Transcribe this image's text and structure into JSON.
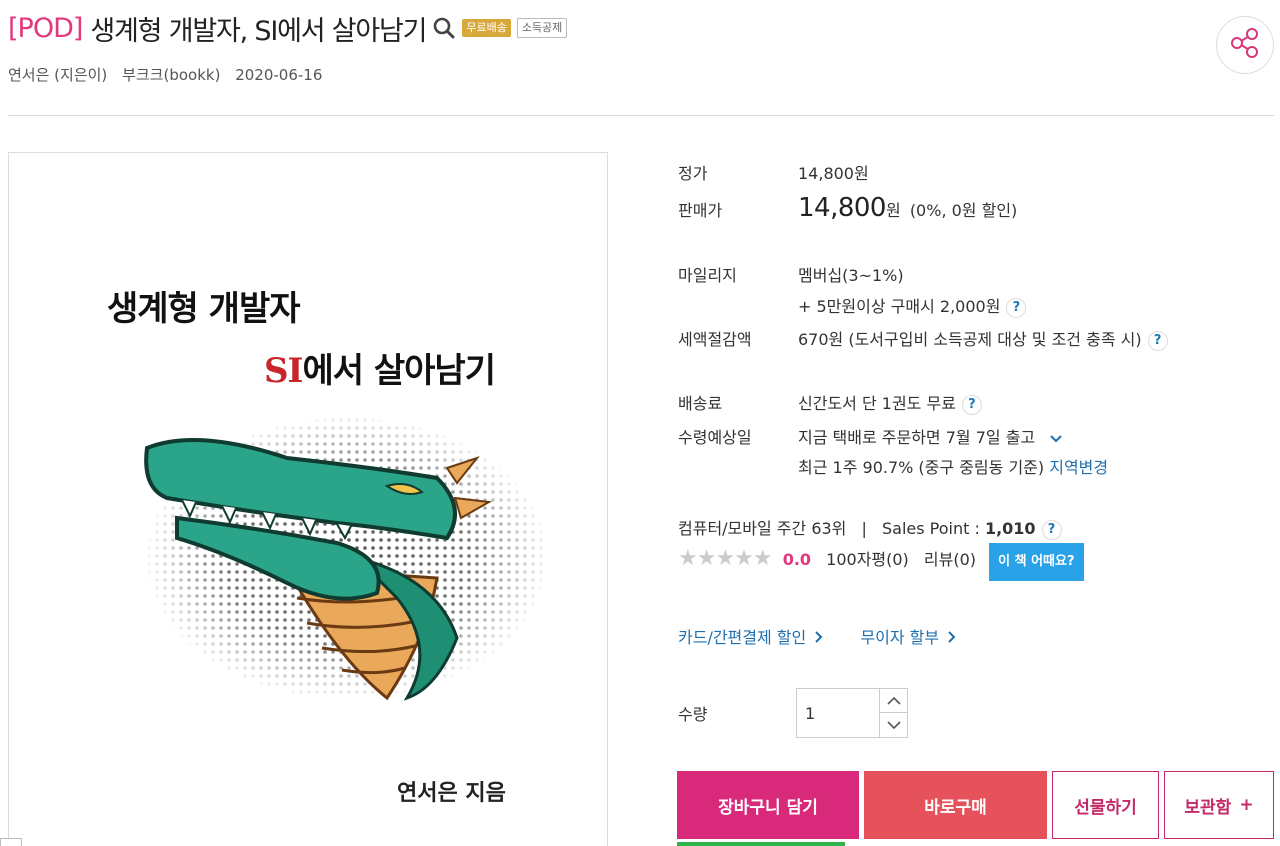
{
  "header": {
    "pod_tag": "[POD]",
    "title": "생계형 개발자, SI에서 살아남기",
    "badges": [
      "무료배송",
      "소득공제"
    ],
    "author": "연서은 (지은이)",
    "publisher": "부크크(bookk)",
    "date": "2020-06-16"
  },
  "cover": {
    "line1": "생계형 개발자",
    "line2_accent": "SI",
    "line2_rest": "에서 살아남기",
    "author": "연서은 지음"
  },
  "pricing": {
    "list_label": "정가",
    "list_price": "14,800원",
    "sale_label": "판매가",
    "sale_price": "14,800",
    "sale_unit": "원",
    "discount": "(0%, 0원 할인)"
  },
  "mileage": {
    "label": "마일리지",
    "line1": "멤버십(3~1%)",
    "line2": "+ 5만원이상 구매시 2,000원"
  },
  "tax": {
    "label": "세액절감액",
    "value": "670원 (도서구입비 소득공제 대상 및 조건 충족 시)"
  },
  "shipping": {
    "label": "배송료",
    "value": "신간도서 단 1권도 무료"
  },
  "delivery": {
    "label": "수령예상일",
    "line1": "지금 택배로 주문하면 7월 7일 출고",
    "line2": "최근 1주 90.7% (중구 중림동 기준)",
    "region_link": "지역변경"
  },
  "rank": {
    "text": "컴퓨터/모바일 주간 63위",
    "sep": "|",
    "sales_label": "Sales Point : ",
    "sales_value": "1,010"
  },
  "rating": {
    "stars": "★★★★★",
    "score": "0.0",
    "reviews100": "100자평(0)",
    "reviews": "리뷰(0)",
    "review_btn": "이 책 어때요?"
  },
  "payment": {
    "card": "카드/간편결제 할인",
    "installment": "무이자 할부"
  },
  "quantity": {
    "label": "수량",
    "value": "1"
  },
  "actions": {
    "cart": "장바구니 담기",
    "buy": "바로구매",
    "gift": "선물하기",
    "keep": "보관함",
    "keep_plus": "+"
  },
  "icons": [
    "search-icon",
    "share-icon",
    "help-icon",
    "chevron-down-icon",
    "chevron-right-icon",
    "chevron-up-icon"
  ],
  "colors": {
    "brand_pink": "#e4387d",
    "buy_red": "#e5525c",
    "link_blue": "#1e6fb0",
    "review_blue": "#2aa2e8",
    "badge_gold": "#d8a83a"
  }
}
